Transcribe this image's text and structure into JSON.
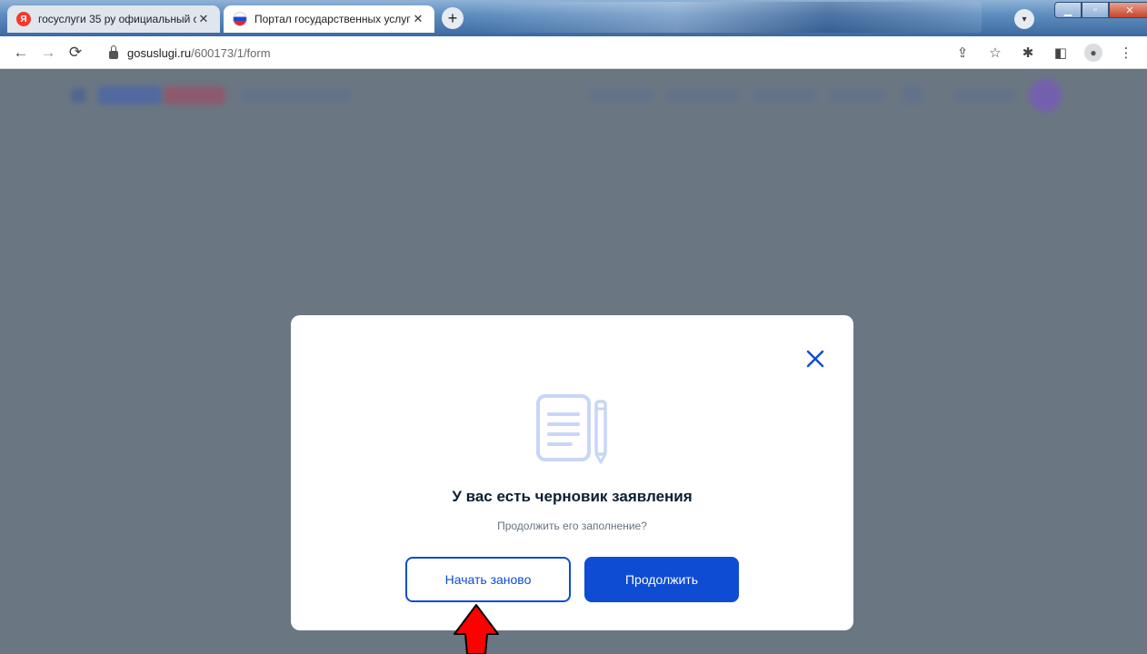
{
  "browser": {
    "tabs": [
      {
        "title": "госуслуги 35 ру официальный с",
        "favicon": "yandex-icon",
        "active": false
      },
      {
        "title": "Портал государственных услуг Р",
        "favicon": "russia-flag-icon",
        "active": true
      }
    ],
    "new_tab": "+",
    "url_host": "gosuslugi.ru",
    "url_path": "/600173/1/form"
  },
  "modal": {
    "title": "У вас есть черновик заявления",
    "subtitle": "Продолжить его заполнение?",
    "restart_label": "Начать заново",
    "continue_label": "Продолжить"
  },
  "colors": {
    "primary": "#0d4cd3",
    "overlay": "#6b7683",
    "annotation_arrow": "#ff0000"
  }
}
